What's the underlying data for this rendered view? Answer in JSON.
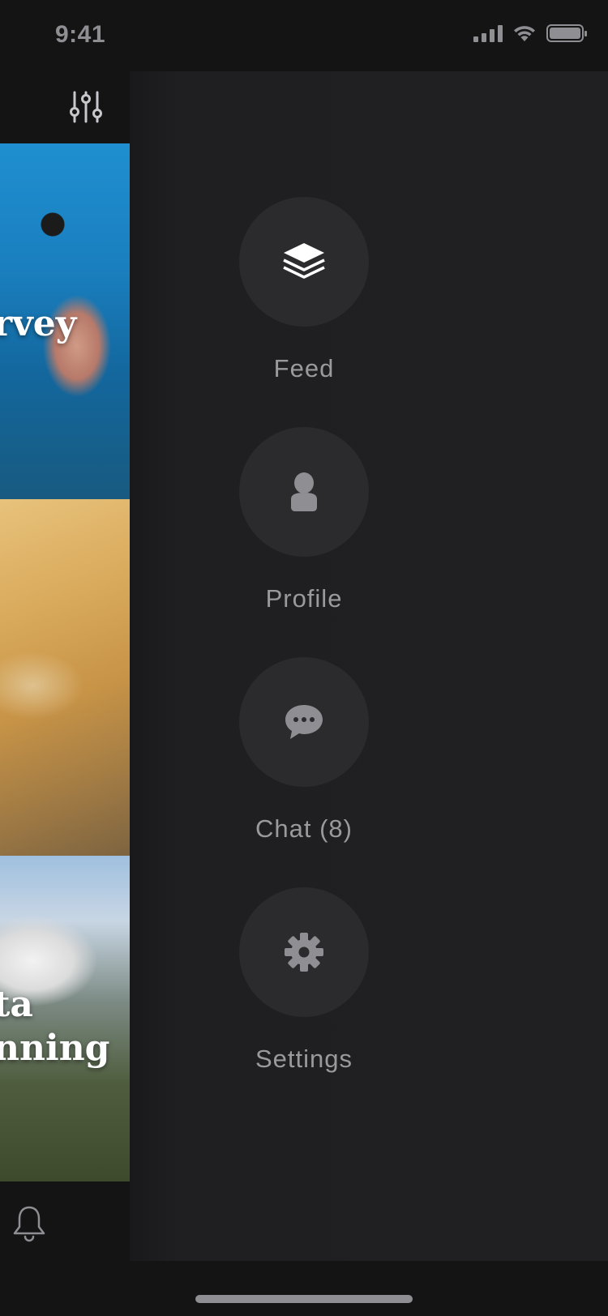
{
  "status_bar": {
    "time": "9:41",
    "icons": [
      "cellular-signal-icon",
      "wifi-icon",
      "battery-icon"
    ]
  },
  "background_feed": {
    "top_icon": "filter-sliders-icon",
    "cards": [
      {
        "title_fragment": "rvey"
      },
      {
        "title_fragment": ""
      },
      {
        "title_lines": [
          "ta",
          "nning"
        ]
      }
    ],
    "bottom_icon": "bell-icon"
  },
  "drawer": {
    "menu": [
      {
        "id": "feed",
        "label": "Feed",
        "icon": "layers-icon",
        "icon_color": "#ffffff"
      },
      {
        "id": "profile",
        "label": "Profile",
        "icon": "person-icon",
        "icon_color": "#8e8e93"
      },
      {
        "id": "chat",
        "label": "Chat (8)",
        "icon": "chat-bubble-icon",
        "icon_color": "#8e8e93"
      },
      {
        "id": "settings",
        "label": "Settings",
        "icon": "gear-icon",
        "icon_color": "#8e8e93"
      }
    ]
  },
  "colors": {
    "background": "#141415",
    "drawer": "#202022",
    "circle": "#2b2b2d",
    "label": "#9a9a9e",
    "active_icon": "#ffffff",
    "inactive_icon": "#8e8e93"
  }
}
